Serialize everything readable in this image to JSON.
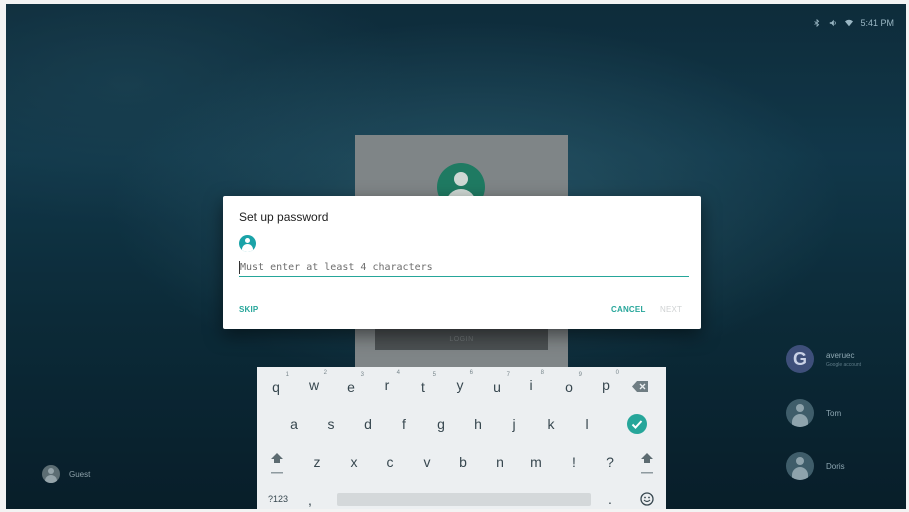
{
  "status_bar": {
    "time": "5:41 PM",
    "icons": [
      "bluetooth-icon",
      "volume-icon",
      "wifi-icon"
    ]
  },
  "lock_screen": {
    "login_label": "LOGIN"
  },
  "dialog": {
    "title": "Set up password",
    "password_placeholder": "Must enter at least 4 characters",
    "skip_label": "SKIP",
    "cancel_label": "CANCEL",
    "next_label": "NEXT"
  },
  "users": [
    {
      "name": "averuec",
      "subtitle": "Google account",
      "icon": "google-icon"
    },
    {
      "name": "Tom",
      "icon": "person-icon"
    },
    {
      "name": "Doris",
      "icon": "person-icon"
    }
  ],
  "guest": {
    "label": "Guest"
  },
  "keyboard": {
    "row1": [
      {
        "key": "q",
        "hint": "1"
      },
      {
        "key": "w",
        "hint": "2"
      },
      {
        "key": "e",
        "hint": "3"
      },
      {
        "key": "r",
        "hint": "4"
      },
      {
        "key": "t",
        "hint": "5"
      },
      {
        "key": "y",
        "hint": "6"
      },
      {
        "key": "u",
        "hint": "7"
      },
      {
        "key": "i",
        "hint": "8"
      },
      {
        "key": "o",
        "hint": "9"
      },
      {
        "key": "p",
        "hint": "0"
      }
    ],
    "row2": [
      "a",
      "s",
      "d",
      "f",
      "g",
      "h",
      "j",
      "k",
      "l"
    ],
    "row3": [
      "z",
      "x",
      "c",
      "v",
      "b",
      "n",
      "m",
      "!",
      "?"
    ],
    "symbols_label": "?123",
    "comma": ",",
    "period": ".",
    "accent_color": "#26a69a"
  }
}
